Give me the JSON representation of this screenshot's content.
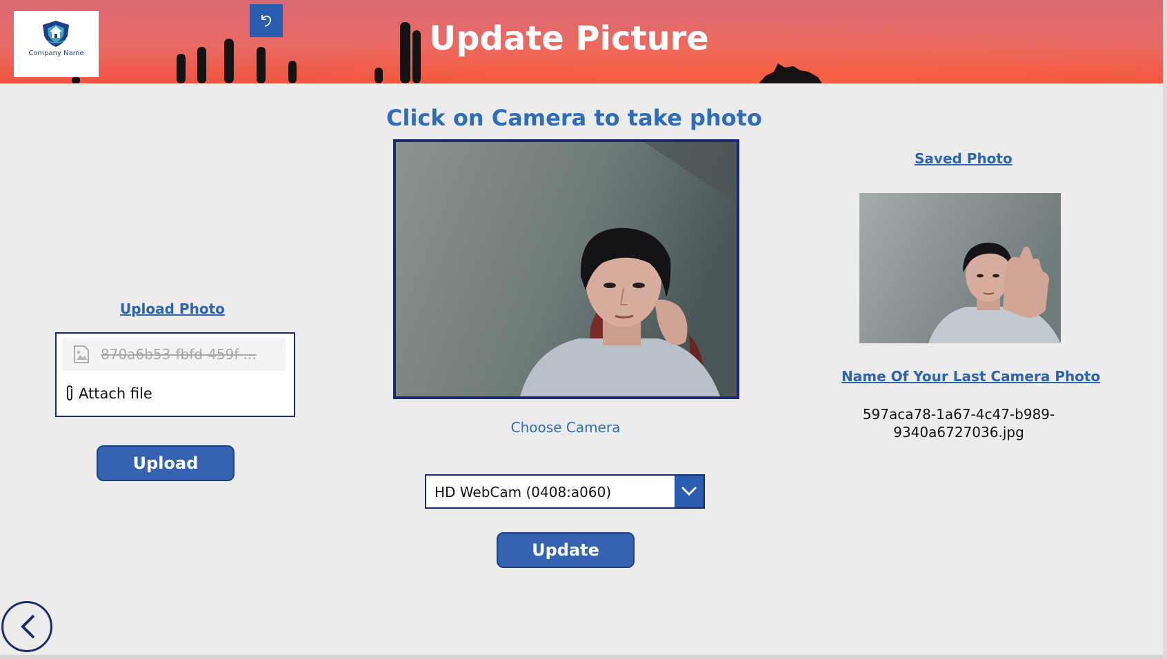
{
  "header": {
    "title": "Update Picture",
    "logo_text": "Company Name"
  },
  "upload": {
    "label": "Upload Photo",
    "file_name": "870a6b53-fbfd-459f-...",
    "attach_label": "Attach file",
    "button_label": "Upload"
  },
  "camera": {
    "instruction": "Click on Camera to take photo",
    "choose_label": "Choose Camera",
    "selected_camera": "HD WebCam (0408:a060)",
    "update_label": "Update"
  },
  "saved": {
    "label": "Saved Photo",
    "last_photo_label": "Name Of Your Last Camera Photo",
    "last_photo_name": "597aca78-1a67-4c47-b989-9340a6727036.jpg"
  },
  "colors": {
    "accent": "#2f63ad",
    "button": "#3563b2",
    "border": "#1b2a6d",
    "header": "#ea6a64"
  },
  "icons": [
    "company-logo",
    "image-file-icon",
    "undo-icon",
    "paperclip-icon",
    "chevron-down-icon",
    "back-arrow-icon"
  ]
}
